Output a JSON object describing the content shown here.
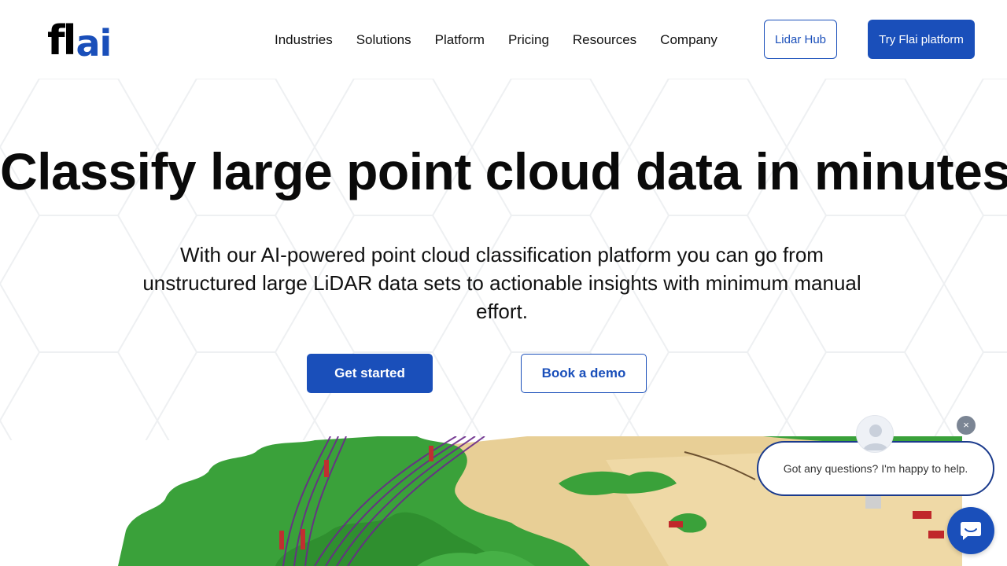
{
  "logo": {
    "text_f": "fl",
    "text_ai": "ai"
  },
  "nav": {
    "items": [
      {
        "label": "Industries"
      },
      {
        "label": "Solutions"
      },
      {
        "label": "Platform"
      },
      {
        "label": "Pricing"
      },
      {
        "label": "Resources"
      },
      {
        "label": "Company"
      }
    ],
    "lidar_hub_label": "Lidar Hub",
    "try_label": "Try Flai platform"
  },
  "hero": {
    "title": "Classify large point cloud data in minutes",
    "subtitle": "With our AI-powered point cloud classification platform you can go from unstructured large LiDAR data sets to actionable insights with minimum manual effort.",
    "get_started_label": "Get started",
    "book_demo_label": "Book a demo"
  },
  "chat": {
    "message": "Got any questions? I'm happy to help.",
    "close_glyph": "×",
    "avatar_icon": "person-icon",
    "launcher_icon": "chat-bubble-icon"
  },
  "colors": {
    "brand_blue": "#1a4fba",
    "chat_border": "#1a3a8c",
    "foliage_green": "#3aa13a",
    "terrain_tan": "#e8cf96",
    "powerline_purple": "#6a2a8a"
  }
}
